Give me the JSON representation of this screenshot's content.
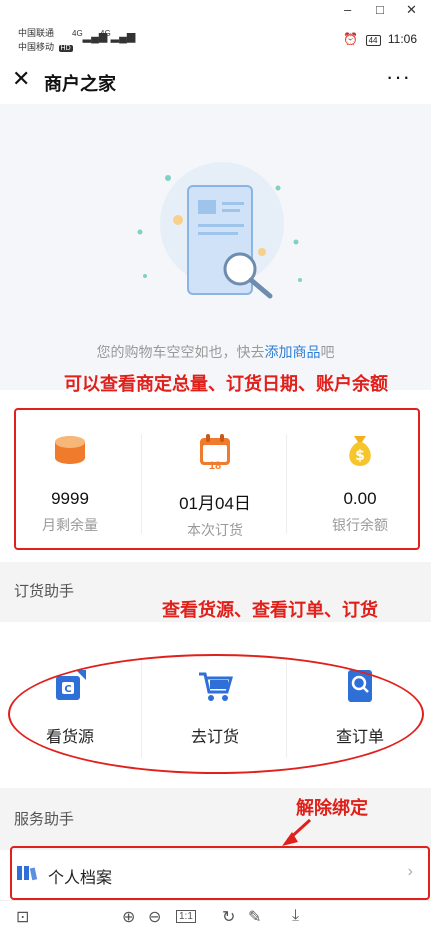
{
  "window": {
    "minimize": "–",
    "maximize": "□",
    "close": "✕"
  },
  "statusbar": {
    "carrier1": "中国联通",
    "carrier2": "中国移动",
    "hd": "HD",
    "net1": "4G",
    "net2": "4G",
    "time": "11:06",
    "battery": "44"
  },
  "titlebar": {
    "title": "商户之家",
    "close": "✕",
    "more": "···"
  },
  "empty_cart": {
    "text_prefix": "您的购物车空空如也，快去",
    "link": "添加商品",
    "text_suffix": "吧"
  },
  "annotations": {
    "a1": "可以查看商定总量、订货日期、账户余额",
    "a2": "查看货源、查看订单、订货",
    "a3": "解除绑定"
  },
  "stats": [
    {
      "value": "9999",
      "label": "月剩余量",
      "icon": "coin-stack-icon"
    },
    {
      "value": "01月04日",
      "label": "本次订货",
      "icon": "calendar-icon",
      "badge": "18"
    },
    {
      "value": "0.00",
      "label": "银行余额",
      "icon": "money-bag-icon"
    }
  ],
  "order_section": {
    "title": "订货助手"
  },
  "helpers": [
    {
      "label": "看货源",
      "icon": "source-icon"
    },
    {
      "label": "去订货",
      "icon": "cart-icon"
    },
    {
      "label": "查订单",
      "icon": "order-search-icon"
    }
  ],
  "service_section": {
    "title": "服务助手"
  },
  "profile": {
    "label": "个人档案",
    "chevron": "›"
  },
  "colors": {
    "accent": "#2e7ed6",
    "orange": "#f07b2c",
    "annotation": "#e0201b"
  }
}
